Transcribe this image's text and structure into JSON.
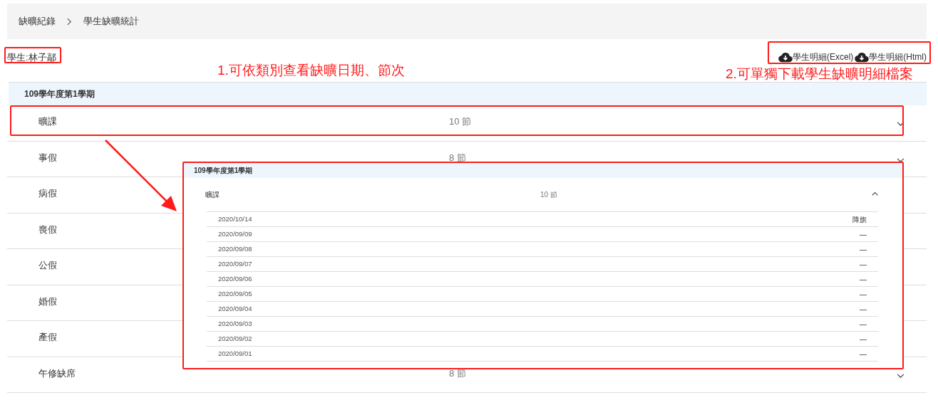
{
  "breadcrumb": [
    {
      "label": "缺曠紀錄"
    },
    {
      "label": "學生缺曠統計"
    }
  ],
  "student": "學生:林子鄗",
  "downloads": [
    {
      "label": "學生明細(Excel)"
    },
    {
      "label": "學生明細(Html)"
    }
  ],
  "semester": "109學年度第1學期",
  "categories": [
    {
      "label": "曠課",
      "count": "10 節",
      "expanded": false
    },
    {
      "label": "事假",
      "count": "8 節",
      "expanded": false
    },
    {
      "label": "病假"
    },
    {
      "label": "喪假"
    },
    {
      "label": "公假"
    },
    {
      "label": "婚假"
    },
    {
      "label": "產假"
    },
    {
      "label": "午修缺席",
      "count": "8 節",
      "expanded": false
    }
  ],
  "inset": {
    "semester": "109學年度第1學期",
    "category": {
      "label": "曠課",
      "count": "10 節",
      "expanded": true
    },
    "records": [
      {
        "date": "2020/10/14",
        "period": "降旗"
      },
      {
        "date": "2020/09/09",
        "period": "—"
      },
      {
        "date": "2020/09/08",
        "period": "—"
      },
      {
        "date": "2020/09/07",
        "period": "—"
      },
      {
        "date": "2020/09/06",
        "period": "—"
      },
      {
        "date": "2020/09/05",
        "period": "—"
      },
      {
        "date": "2020/09/04",
        "period": "—"
      },
      {
        "date": "2020/09/03",
        "period": "—"
      },
      {
        "date": "2020/09/02",
        "period": "—"
      },
      {
        "date": "2020/09/01",
        "period": "—"
      }
    ]
  },
  "annotations": [
    {
      "text": "1.可依類別查看缺曠日期、節次"
    },
    {
      "text": "2.可單獨下載學生缺曠明細檔案"
    }
  ]
}
